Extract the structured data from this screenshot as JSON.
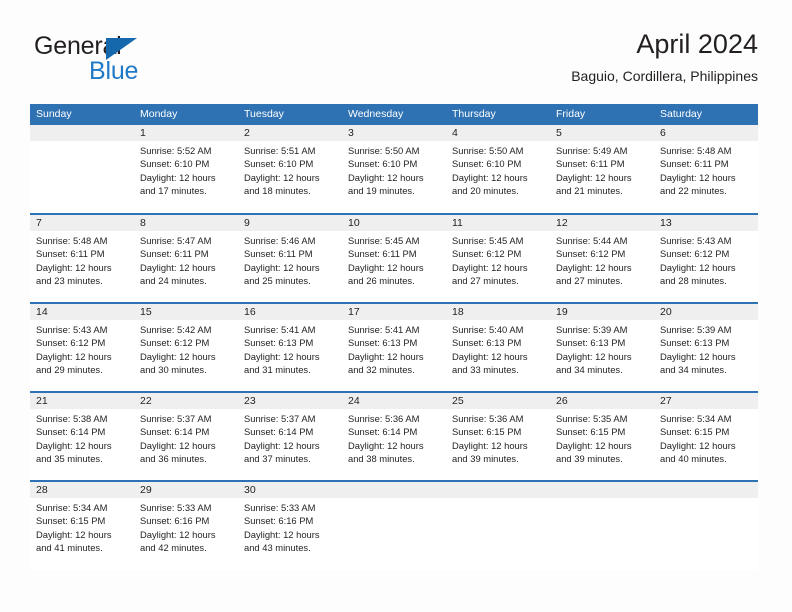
{
  "brand": {
    "name_part1": "General",
    "name_part2": "Blue",
    "logo_icon": "triangle-flag-icon"
  },
  "header": {
    "title": "April 2024",
    "subtitle": "Baguio, Cordillera, Philippines"
  },
  "colors": {
    "header_blue": "#2f72b3",
    "daynum_gray": "#efefef",
    "brand_blue": "#1e7ac6",
    "text": "#231f20"
  },
  "weekdays": [
    "Sunday",
    "Monday",
    "Tuesday",
    "Wednesday",
    "Thursday",
    "Friday",
    "Saturday"
  ],
  "weeks": [
    [
      {
        "day": "",
        "sunrise": "",
        "sunset": "",
        "daylight1": "",
        "daylight2": ""
      },
      {
        "day": "1",
        "sunrise": "Sunrise: 5:52 AM",
        "sunset": "Sunset: 6:10 PM",
        "daylight1": "Daylight: 12 hours",
        "daylight2": "and 17 minutes."
      },
      {
        "day": "2",
        "sunrise": "Sunrise: 5:51 AM",
        "sunset": "Sunset: 6:10 PM",
        "daylight1": "Daylight: 12 hours",
        "daylight2": "and 18 minutes."
      },
      {
        "day": "3",
        "sunrise": "Sunrise: 5:50 AM",
        "sunset": "Sunset: 6:10 PM",
        "daylight1": "Daylight: 12 hours",
        "daylight2": "and 19 minutes."
      },
      {
        "day": "4",
        "sunrise": "Sunrise: 5:50 AM",
        "sunset": "Sunset: 6:10 PM",
        "daylight1": "Daylight: 12 hours",
        "daylight2": "and 20 minutes."
      },
      {
        "day": "5",
        "sunrise": "Sunrise: 5:49 AM",
        "sunset": "Sunset: 6:11 PM",
        "daylight1": "Daylight: 12 hours",
        "daylight2": "and 21 minutes."
      },
      {
        "day": "6",
        "sunrise": "Sunrise: 5:48 AM",
        "sunset": "Sunset: 6:11 PM",
        "daylight1": "Daylight: 12 hours",
        "daylight2": "and 22 minutes."
      }
    ],
    [
      {
        "day": "7",
        "sunrise": "Sunrise: 5:48 AM",
        "sunset": "Sunset: 6:11 PM",
        "daylight1": "Daylight: 12 hours",
        "daylight2": "and 23 minutes."
      },
      {
        "day": "8",
        "sunrise": "Sunrise: 5:47 AM",
        "sunset": "Sunset: 6:11 PM",
        "daylight1": "Daylight: 12 hours",
        "daylight2": "and 24 minutes."
      },
      {
        "day": "9",
        "sunrise": "Sunrise: 5:46 AM",
        "sunset": "Sunset: 6:11 PM",
        "daylight1": "Daylight: 12 hours",
        "daylight2": "and 25 minutes."
      },
      {
        "day": "10",
        "sunrise": "Sunrise: 5:45 AM",
        "sunset": "Sunset: 6:11 PM",
        "daylight1": "Daylight: 12 hours",
        "daylight2": "and 26 minutes."
      },
      {
        "day": "11",
        "sunrise": "Sunrise: 5:45 AM",
        "sunset": "Sunset: 6:12 PM",
        "daylight1": "Daylight: 12 hours",
        "daylight2": "and 27 minutes."
      },
      {
        "day": "12",
        "sunrise": "Sunrise: 5:44 AM",
        "sunset": "Sunset: 6:12 PM",
        "daylight1": "Daylight: 12 hours",
        "daylight2": "and 27 minutes."
      },
      {
        "day": "13",
        "sunrise": "Sunrise: 5:43 AM",
        "sunset": "Sunset: 6:12 PM",
        "daylight1": "Daylight: 12 hours",
        "daylight2": "and 28 minutes."
      }
    ],
    [
      {
        "day": "14",
        "sunrise": "Sunrise: 5:43 AM",
        "sunset": "Sunset: 6:12 PM",
        "daylight1": "Daylight: 12 hours",
        "daylight2": "and 29 minutes."
      },
      {
        "day": "15",
        "sunrise": "Sunrise: 5:42 AM",
        "sunset": "Sunset: 6:12 PM",
        "daylight1": "Daylight: 12 hours",
        "daylight2": "and 30 minutes."
      },
      {
        "day": "16",
        "sunrise": "Sunrise: 5:41 AM",
        "sunset": "Sunset: 6:13 PM",
        "daylight1": "Daylight: 12 hours",
        "daylight2": "and 31 minutes."
      },
      {
        "day": "17",
        "sunrise": "Sunrise: 5:41 AM",
        "sunset": "Sunset: 6:13 PM",
        "daylight1": "Daylight: 12 hours",
        "daylight2": "and 32 minutes."
      },
      {
        "day": "18",
        "sunrise": "Sunrise: 5:40 AM",
        "sunset": "Sunset: 6:13 PM",
        "daylight1": "Daylight: 12 hours",
        "daylight2": "and 33 minutes."
      },
      {
        "day": "19",
        "sunrise": "Sunrise: 5:39 AM",
        "sunset": "Sunset: 6:13 PM",
        "daylight1": "Daylight: 12 hours",
        "daylight2": "and 34 minutes."
      },
      {
        "day": "20",
        "sunrise": "Sunrise: 5:39 AM",
        "sunset": "Sunset: 6:13 PM",
        "daylight1": "Daylight: 12 hours",
        "daylight2": "and 34 minutes."
      }
    ],
    [
      {
        "day": "21",
        "sunrise": "Sunrise: 5:38 AM",
        "sunset": "Sunset: 6:14 PM",
        "daylight1": "Daylight: 12 hours",
        "daylight2": "and 35 minutes."
      },
      {
        "day": "22",
        "sunrise": "Sunrise: 5:37 AM",
        "sunset": "Sunset: 6:14 PM",
        "daylight1": "Daylight: 12 hours",
        "daylight2": "and 36 minutes."
      },
      {
        "day": "23",
        "sunrise": "Sunrise: 5:37 AM",
        "sunset": "Sunset: 6:14 PM",
        "daylight1": "Daylight: 12 hours",
        "daylight2": "and 37 minutes."
      },
      {
        "day": "24",
        "sunrise": "Sunrise: 5:36 AM",
        "sunset": "Sunset: 6:14 PM",
        "daylight1": "Daylight: 12 hours",
        "daylight2": "and 38 minutes."
      },
      {
        "day": "25",
        "sunrise": "Sunrise: 5:36 AM",
        "sunset": "Sunset: 6:15 PM",
        "daylight1": "Daylight: 12 hours",
        "daylight2": "and 39 minutes."
      },
      {
        "day": "26",
        "sunrise": "Sunrise: 5:35 AM",
        "sunset": "Sunset: 6:15 PM",
        "daylight1": "Daylight: 12 hours",
        "daylight2": "and 39 minutes."
      },
      {
        "day": "27",
        "sunrise": "Sunrise: 5:34 AM",
        "sunset": "Sunset: 6:15 PM",
        "daylight1": "Daylight: 12 hours",
        "daylight2": "and 40 minutes."
      }
    ],
    [
      {
        "day": "28",
        "sunrise": "Sunrise: 5:34 AM",
        "sunset": "Sunset: 6:15 PM",
        "daylight1": "Daylight: 12 hours",
        "daylight2": "and 41 minutes."
      },
      {
        "day": "29",
        "sunrise": "Sunrise: 5:33 AM",
        "sunset": "Sunset: 6:16 PM",
        "daylight1": "Daylight: 12 hours",
        "daylight2": "and 42 minutes."
      },
      {
        "day": "30",
        "sunrise": "Sunrise: 5:33 AM",
        "sunset": "Sunset: 6:16 PM",
        "daylight1": "Daylight: 12 hours",
        "daylight2": "and 43 minutes."
      },
      {
        "day": "",
        "sunrise": "",
        "sunset": "",
        "daylight1": "",
        "daylight2": ""
      },
      {
        "day": "",
        "sunrise": "",
        "sunset": "",
        "daylight1": "",
        "daylight2": ""
      },
      {
        "day": "",
        "sunrise": "",
        "sunset": "",
        "daylight1": "",
        "daylight2": ""
      },
      {
        "day": "",
        "sunrise": "",
        "sunset": "",
        "daylight1": "",
        "daylight2": ""
      }
    ]
  ]
}
